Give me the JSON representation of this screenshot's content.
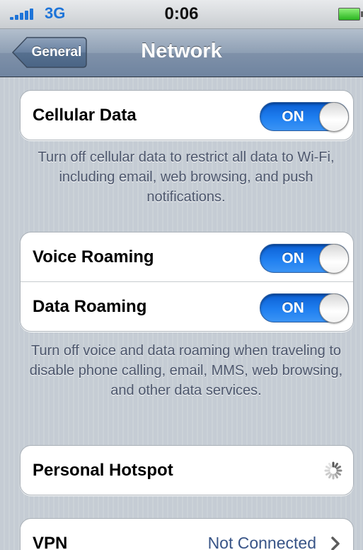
{
  "status_bar": {
    "carrier": "3G",
    "time": "0:06",
    "signal_bars": 5
  },
  "nav": {
    "back_label": "General",
    "title": "Network"
  },
  "cellular": {
    "label": "Cellular Data",
    "toggle": "ON",
    "footer": "Turn off cellular data to restrict all data to Wi-Fi, including email, web browsing, and push notifications."
  },
  "roaming": {
    "voice_label": "Voice Roaming",
    "voice_toggle": "ON",
    "data_label": "Data Roaming",
    "data_toggle": "ON",
    "footer": "Turn off voice and data roaming when traveling to disable phone calling, email, MMS, web browsing, and other data services."
  },
  "hotspot": {
    "label": "Personal Hotspot",
    "status_icon": "loading-spinner-icon"
  },
  "vpn": {
    "label": "VPN",
    "value": "Not Connected",
    "disclosure_icon": "chevron-right-icon"
  },
  "colors": {
    "switch_on": "#1f7ff0",
    "nav_bar": "#8e9fb4",
    "carrier_text": "#1e74d8",
    "detail_text": "#385487",
    "background": "#c5ccd4"
  }
}
